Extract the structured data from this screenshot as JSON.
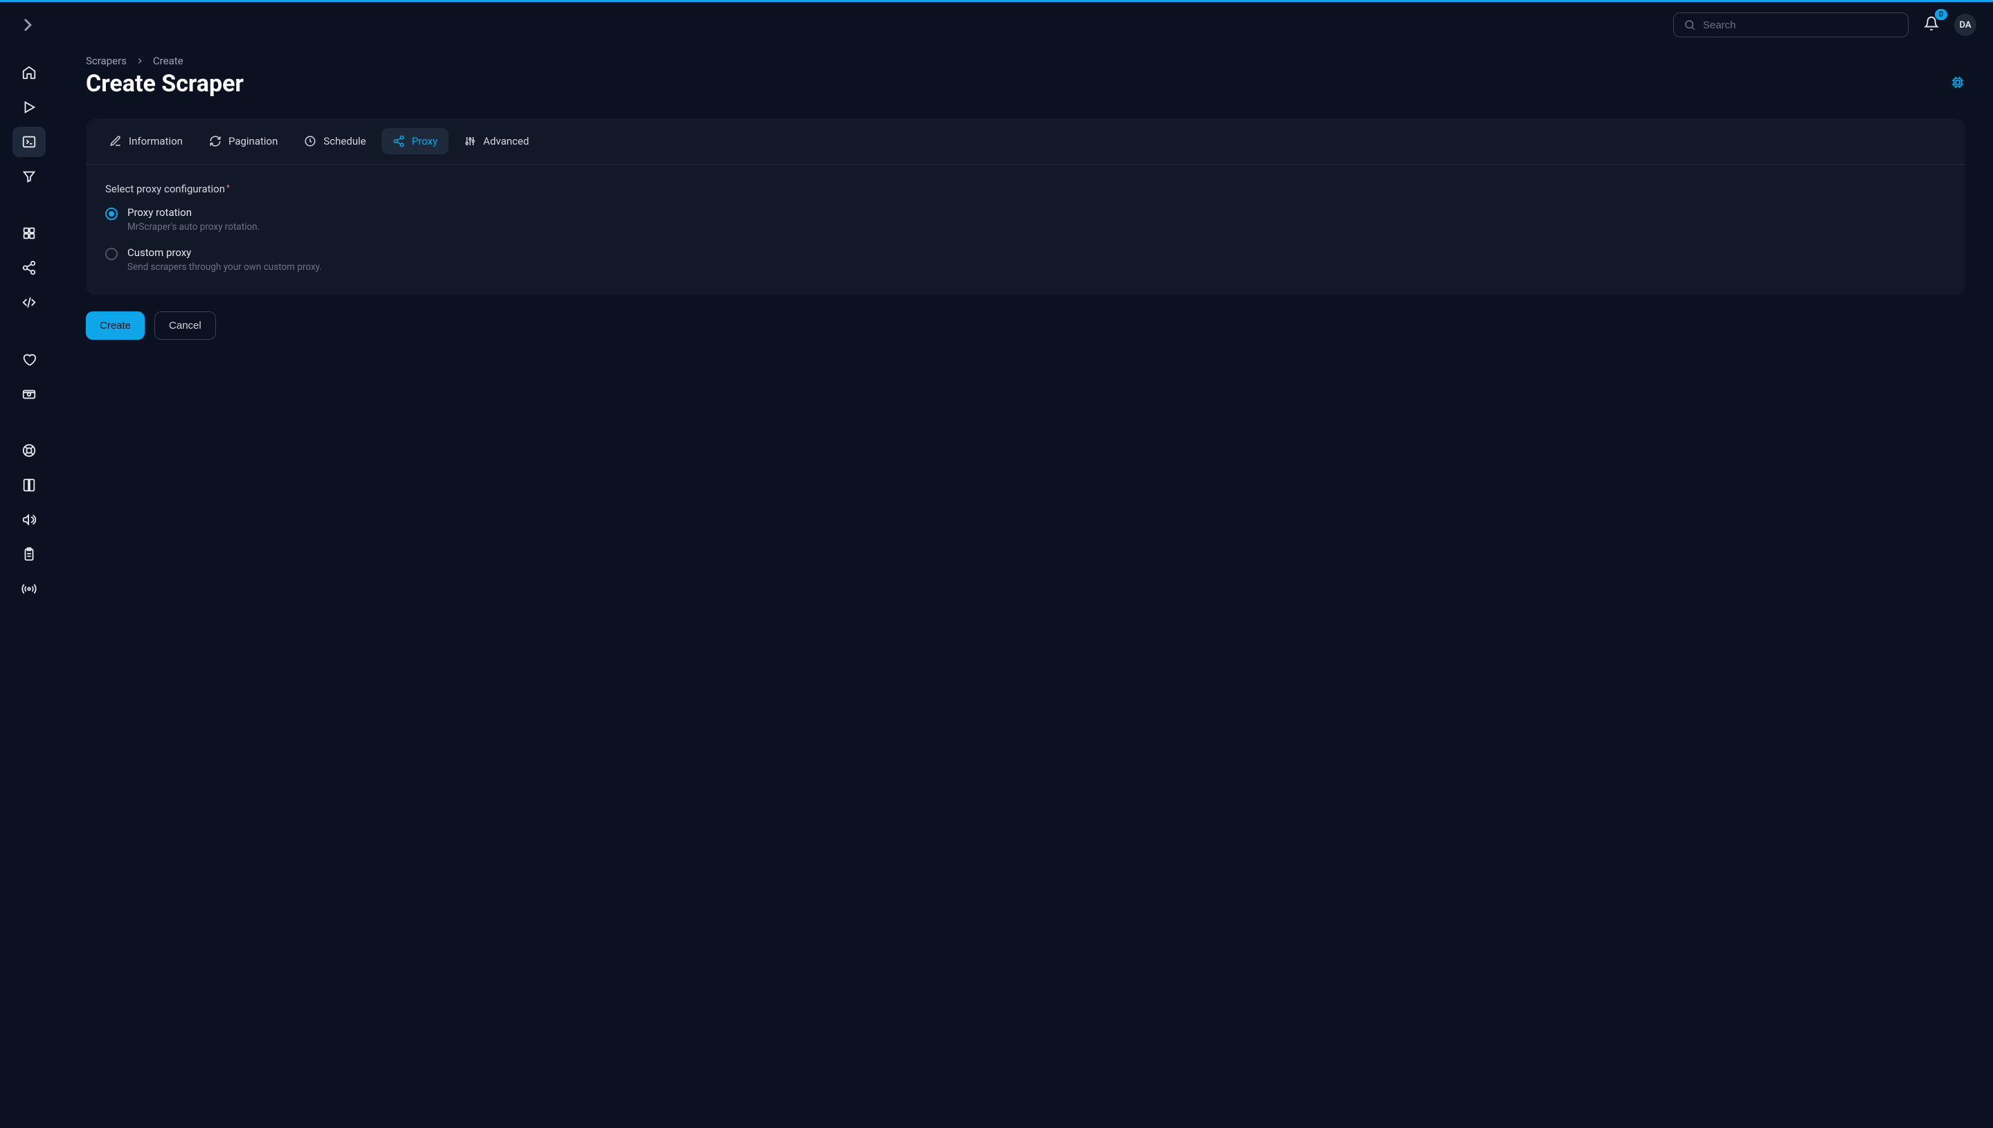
{
  "header": {
    "search_placeholder": "Search",
    "notifications_count": "0",
    "avatar_initials": "DA"
  },
  "breadcrumb": {
    "root": "Scrapers",
    "current": "Create"
  },
  "page": {
    "title": "Create Scraper"
  },
  "tabs": [
    {
      "id": "information",
      "label": "Information"
    },
    {
      "id": "pagination",
      "label": "Pagination"
    },
    {
      "id": "schedule",
      "label": "Schedule"
    },
    {
      "id": "proxy",
      "label": "Proxy",
      "active": true
    },
    {
      "id": "advanced",
      "label": "Advanced"
    }
  ],
  "proxy_panel": {
    "field_label": "Select proxy configuration",
    "options": [
      {
        "title": "Proxy rotation",
        "desc": "MrScraper's auto proxy rotation.",
        "selected": true
      },
      {
        "title": "Custom proxy",
        "desc": "Send scrapers through your own custom proxy.",
        "selected": false
      }
    ]
  },
  "actions": {
    "primary": "Create",
    "secondary": "Cancel"
  },
  "colors": {
    "accent": "#0ea5e9",
    "bg": "#0b1120",
    "panel": "#111827"
  }
}
